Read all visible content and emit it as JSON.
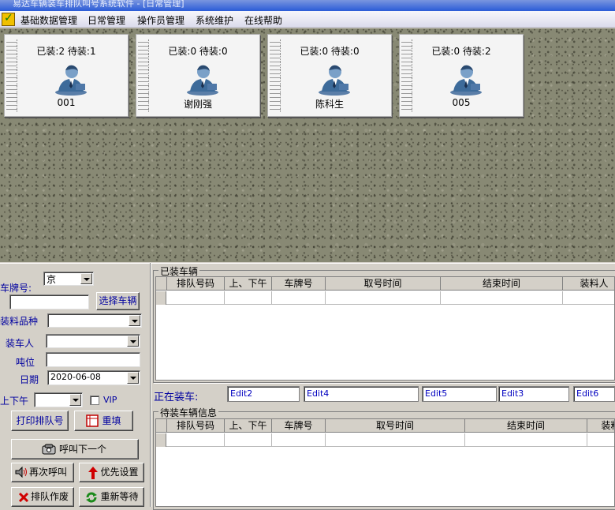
{
  "window": {
    "title": "易达车辆装车排队叫号系统软件    - [日常管理]"
  },
  "menu": [
    "基础数据管理",
    "日常管理",
    "操作员管理",
    "系统维护",
    "在线帮助"
  ],
  "workers": [
    {
      "stat": "已装:2 待装:1",
      "name": "001"
    },
    {
      "stat": "已装:0 待装:0",
      "name": "谢刚强"
    },
    {
      "stat": "已装:0 待装:0",
      "name": "陈科生"
    },
    {
      "stat": "已装:0 待装:2",
      "name": "005"
    }
  ],
  "form": {
    "plate_label": "车牌号:",
    "province_value": "京",
    "plate_value": "",
    "select_vehicle_button": "选择车辆",
    "material_label": "装料品种",
    "material_value": "",
    "loader_label": "装车人",
    "loader_value": "",
    "tonnage_label": "吨位",
    "tonnage_value": "",
    "date_label": "日期",
    "date_value": "2020-06-08",
    "shift_label": "上下午",
    "shift_value": "",
    "vip_label": "VIP",
    "vip_checked": false
  },
  "buttons": {
    "print_ticket": "打印排队号",
    "refill": "重填",
    "call_next": "呼叫下一个",
    "call_again": "再次呼叫",
    "priority": "优先设置",
    "void_ticket": "排队作废",
    "requeue": "重新等待"
  },
  "loaded": {
    "caption": "已装车辆",
    "columns": [
      "排队号码",
      "上、下午",
      "车牌号",
      "取号时间",
      "结束时间",
      "装料人"
    ]
  },
  "loading_now": {
    "label": "正在装车:",
    "fields": [
      "Edit2",
      "Edit4",
      "Edit5",
      "Edit3",
      "Edit6"
    ]
  },
  "waiting": {
    "caption": "待装车辆信息",
    "columns": [
      "排队号码",
      "上、下午",
      "车牌号",
      "取号时间",
      "结束时间",
      "装料"
    ]
  },
  "colors": {
    "label_blue": "#0000a0",
    "edit_text": "#0000c0",
    "panel": "#d4d0c8",
    "title": "#2a5bd7"
  }
}
